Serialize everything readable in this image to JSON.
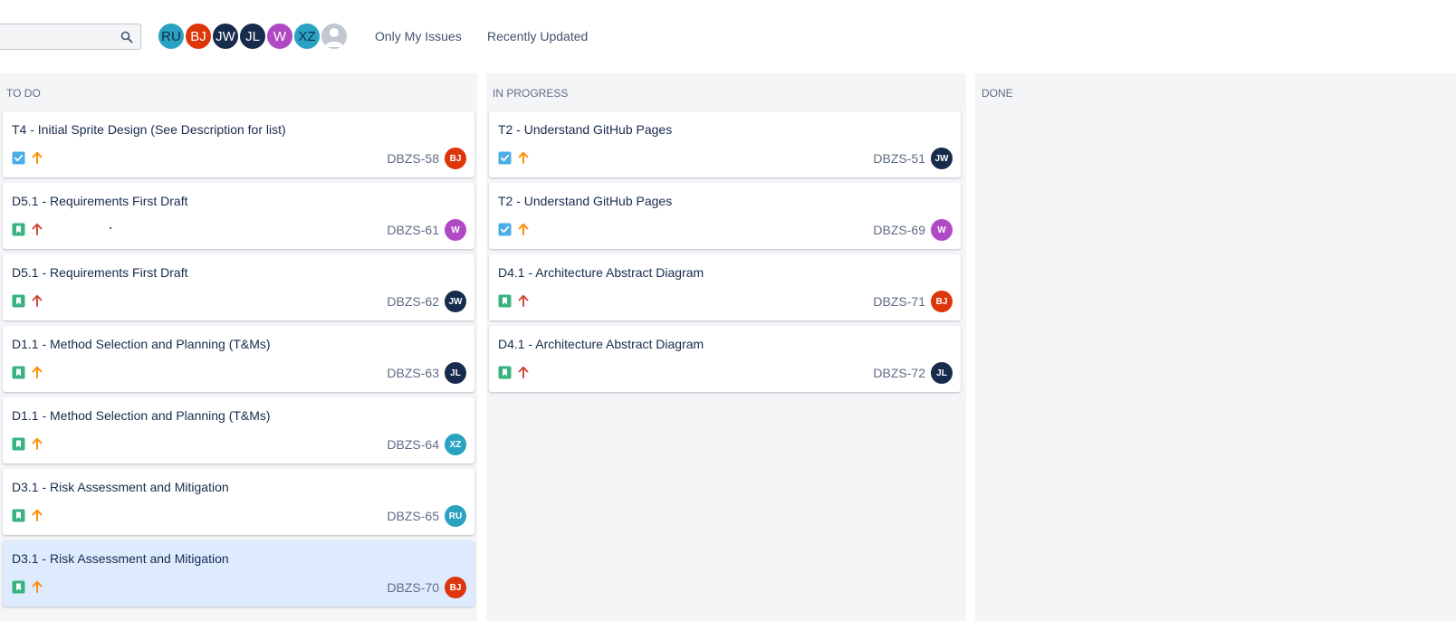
{
  "toolbar": {
    "search": {
      "placeholder": ""
    },
    "avatars": [
      {
        "initials": "RU",
        "color": "#2aa3c2",
        "text_dark": true
      },
      {
        "initials": "BJ",
        "color": "#de350b",
        "text_dark": false
      },
      {
        "initials": "JW",
        "color": "#172b4d",
        "text_dark": false
      },
      {
        "initials": "JL",
        "color": "#172b4d",
        "text_dark": false
      },
      {
        "initials": "W",
        "color": "#b04ac4",
        "text_dark": false
      },
      {
        "initials": "XZ",
        "color": "#2aa3c2",
        "text_dark": true
      }
    ],
    "filters": [
      "Only My Issues",
      "Recently Updated"
    ]
  },
  "colors": {
    "story": "#36b37e",
    "task": "#4bade8",
    "prio_high": "#ff5630",
    "prio_highest": "#d04437",
    "prio_medium": "#ff8b00",
    "avatar": {
      "BJ": "#de350b",
      "JW": "#172b4d",
      "JL": "#172b4d",
      "W": "#b04ac4",
      "XZ": "#2aa3c2",
      "RU": "#2aa3c2"
    }
  },
  "columns": [
    {
      "title": "TO DO",
      "cards": [
        {
          "title": "T4 - Initial Sprite Design (See Description for list)",
          "type": "task",
          "priority": "medium",
          "key": "DBZS-58",
          "assignee": "BJ"
        },
        {
          "title": "D5.1 - Requirements First Draft",
          "type": "story",
          "priority": "highest",
          "key": "DBZS-61",
          "assignee": "W"
        },
        {
          "title": "D5.1 - Requirements First Draft",
          "type": "story",
          "priority": "highest",
          "key": "DBZS-62",
          "assignee": "JW"
        },
        {
          "title": "D1.1 - Method Selection and Planning (T&Ms)",
          "type": "story",
          "priority": "medium",
          "key": "DBZS-63",
          "assignee": "JL"
        },
        {
          "title": "D1.1 - Method Selection and Planning (T&Ms)",
          "type": "story",
          "priority": "medium",
          "key": "DBZS-64",
          "assignee": "XZ"
        },
        {
          "title": "D3.1 - Risk Assessment and Mitigation",
          "type": "story",
          "priority": "medium",
          "key": "DBZS-65",
          "assignee": "RU"
        },
        {
          "title": "D3.1 - Risk Assessment and Mitigation",
          "type": "story",
          "priority": "medium",
          "key": "DBZS-70",
          "assignee": "BJ",
          "selected": true
        }
      ]
    },
    {
      "title": "IN PROGRESS",
      "cards": [
        {
          "title": "T2 - Understand GitHub Pages",
          "type": "task",
          "priority": "medium",
          "key": "DBZS-51",
          "assignee": "JW"
        },
        {
          "title": "T2 - Understand GitHub Pages",
          "type": "task",
          "priority": "medium",
          "key": "DBZS-69",
          "assignee": "W"
        },
        {
          "title": "D4.1 - Architecture Abstract Diagram",
          "type": "story",
          "priority": "highest",
          "key": "DBZS-71",
          "assignee": "BJ"
        },
        {
          "title": "D4.1 - Architecture Abstract Diagram",
          "type": "story",
          "priority": "highest",
          "key": "DBZS-72",
          "assignee": "JL"
        }
      ]
    },
    {
      "title": "DONE",
      "cards": []
    }
  ]
}
